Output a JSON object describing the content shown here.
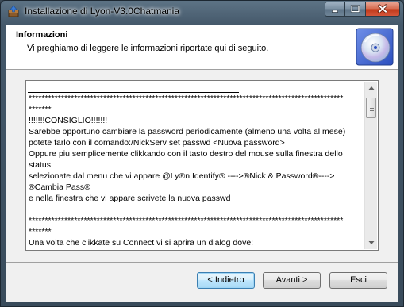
{
  "window": {
    "title": "Installazione di Lyon-V3.0Chatmania",
    "icons": {
      "app": "installer-icon",
      "minimize": "minimize-icon",
      "maximize": "maximize-icon",
      "close": "close-icon"
    }
  },
  "header": {
    "title": "Informazioni",
    "subtitle": "Vi preghiamo di leggere le informazioni riportate qui di seguito.",
    "icon": "cd-disc-icon"
  },
  "info_text": {
    "lines": [
      "",
      "*************************************************************************************************",
      "*******",
      "!!!!!!!CONSIGLIO!!!!!!!",
      "Sarebbe opportuno cambiare la password periodicamente (almeno una volta al mese)",
      "potete farlo con il comando:/NickServ set passwd <Nuova password>",
      "Oppure piu semplicemente clikkando con il tasto destro del mouse sulla finestra dello",
      "status",
      "selezionate dal menu che vi appare @Ly®n Identify® ---->®Nick & Password®---->",
      "®Cambia Pass®",
      "e nella finestra che vi appare scrivete la nuova passwd",
      "",
      "*************************************************************************************************",
      "*******",
      "Una volta che clikkate su Connect vi si aprira un dialog dove:"
    ]
  },
  "buttons": {
    "back": "< Indietro",
    "next": "Avanti >",
    "cancel": "Esci"
  }
}
